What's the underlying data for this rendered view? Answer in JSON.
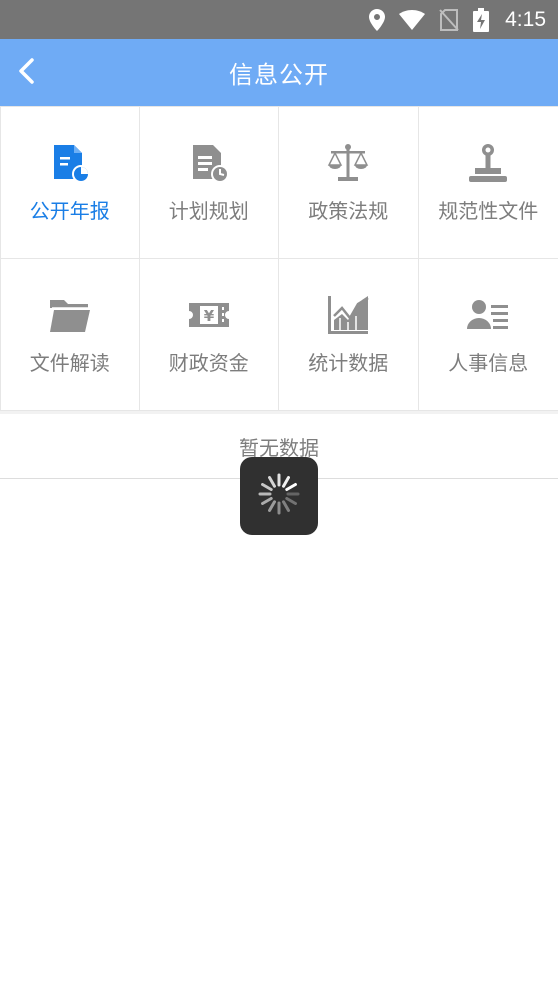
{
  "status_bar": {
    "time": "4:15",
    "icons": [
      "location-icon",
      "wifi-icon",
      "no-sim-icon",
      "battery-charging-icon"
    ]
  },
  "header": {
    "title": "信息公开",
    "back_icon": "chevron-left-icon",
    "background": "#6fabf5"
  },
  "categories": [
    {
      "label": "公开年报",
      "icon": "annual-report-icon",
      "active": true
    },
    {
      "label": "计划规划",
      "icon": "plan-document-icon",
      "active": false
    },
    {
      "label": "政策法规",
      "icon": "scales-icon",
      "active": false
    },
    {
      "label": "规范性文件",
      "icon": "stamp-icon",
      "active": false
    },
    {
      "label": "文件解读",
      "icon": "folder-icon",
      "active": false
    },
    {
      "label": "财政资金",
      "icon": "money-ticket-icon",
      "active": false
    },
    {
      "label": "统计数据",
      "icon": "chart-icon",
      "active": false
    },
    {
      "label": "人事信息",
      "icon": "person-card-icon",
      "active": false
    }
  ],
  "list": {
    "empty_text": "暂无数据"
  },
  "colors": {
    "active": "#1a7ee6",
    "inactive_icon": "#8f8f8f",
    "inactive_text": "#7d7d7d"
  }
}
